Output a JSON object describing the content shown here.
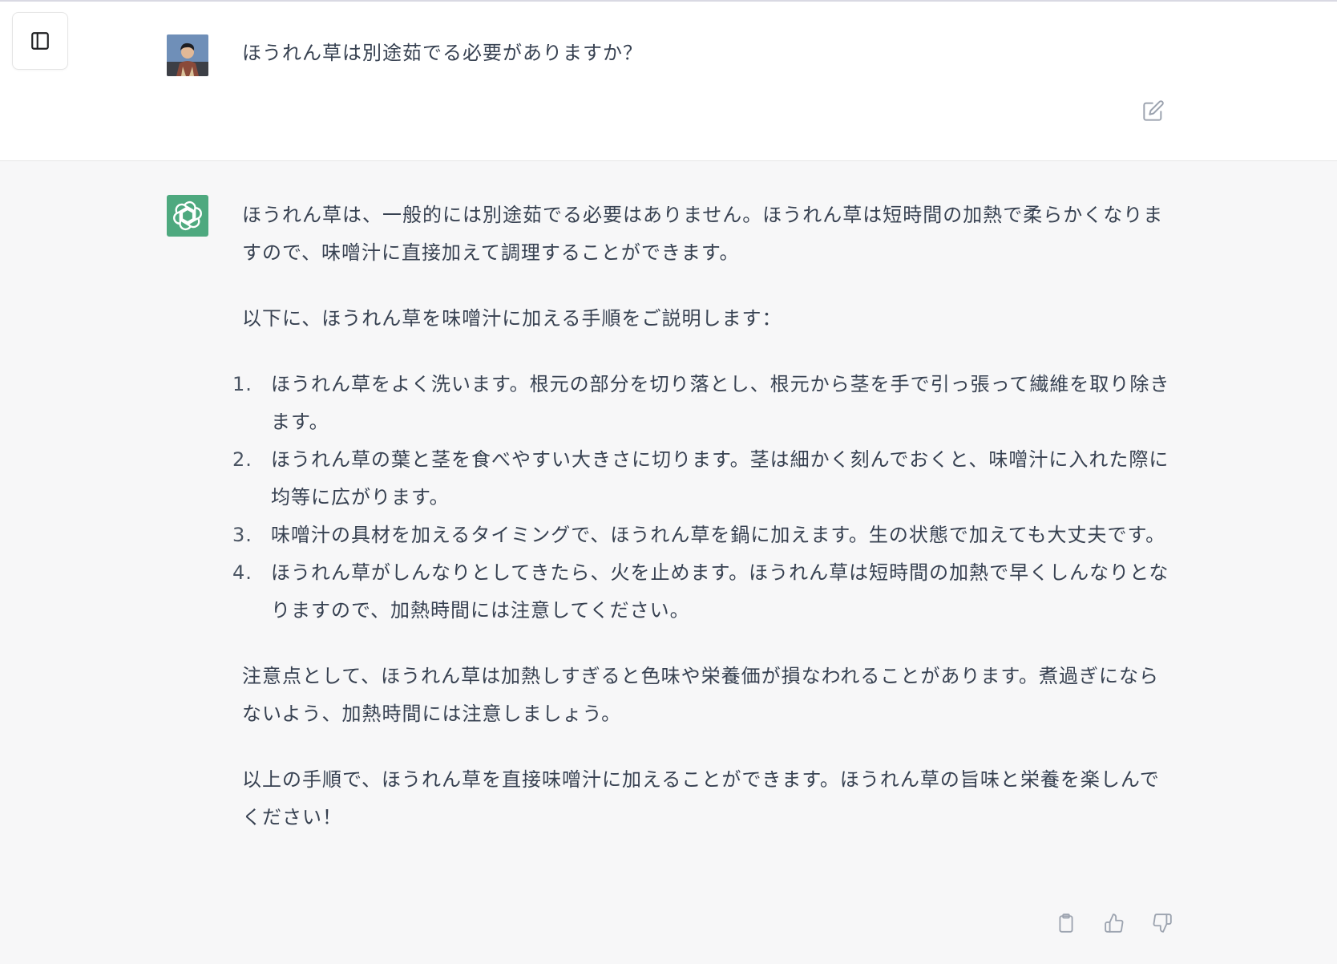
{
  "user_message": {
    "text": "ほうれん草は別途茹でる必要がありますか？"
  },
  "assistant_message": {
    "paragraph_1": "ほうれん草は、一般的には別途茹でる必要はありません。ほうれん草は短時間の加熱で柔らかくなりますので、味噌汁に直接加えて調理することができます。",
    "paragraph_2": "以下に、ほうれん草を味噌汁に加える手順をご説明します：",
    "steps": [
      {
        "num": "1.",
        "text": "ほうれん草をよく洗います。根元の部分を切り落とし、根元から茎を手で引っ張って繊維を取り除きます。"
      },
      {
        "num": "2.",
        "text": "ほうれん草の葉と茎を食べやすい大きさに切ります。茎は細かく刻んでおくと、味噌汁に入れた際に均等に広がります。"
      },
      {
        "num": "3.",
        "text": "味噌汁の具材を加えるタイミングで、ほうれん草を鍋に加えます。生の状態で加えても大丈夫です。"
      },
      {
        "num": "4.",
        "text": "ほうれん草がしんなりとしてきたら、火を止めます。ほうれん草は短時間の加熱で早くしんなりとなりますので、加熱時間には注意してください。"
      }
    ],
    "paragraph_3": "注意点として、ほうれん草は加熱しすぎると色味や栄養価が損なわれることがあります。煮過ぎにならないよう、加熱時間には注意しましょう。",
    "paragraph_4": "以上の手順で、ほうれん草を直接味噌汁に加えることができます。ほうれん草の旨味と栄養を楽しんでください！"
  },
  "icons": {
    "sidebar_toggle": "sidebar-toggle-icon",
    "edit": "edit-icon",
    "copy": "clipboard-icon",
    "thumbs_up": "thumbs-up-icon",
    "thumbs_down": "thumbs-down-icon",
    "assistant_logo": "openai-logo-icon"
  },
  "colors": {
    "assistant_bg": "#f7f7f8",
    "assistant_avatar": "#4ea97f",
    "text": "#374151"
  }
}
